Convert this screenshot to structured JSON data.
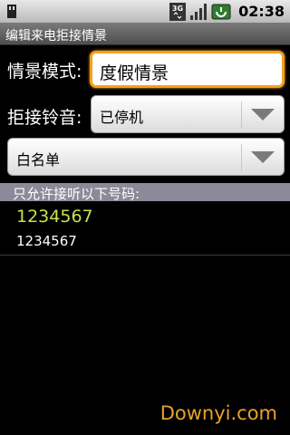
{
  "status_bar": {
    "time": "02:38",
    "network": "3G",
    "left_icon": "sd-card-icon",
    "battery_icon": "battery-charging-icon",
    "signal_icon": "signal-icon"
  },
  "title_bar": {
    "title": "编辑来电拒接情景"
  },
  "scene_mode": {
    "label": "情景模式:",
    "value": "度假情景"
  },
  "reject_ringtone": {
    "label": "拒接铃音:",
    "value": "已停机"
  },
  "list_type": {
    "value": "白名单"
  },
  "allowed_section": {
    "header": "只允许接听以下号码:",
    "numbers": [
      "1234567",
      "1234567"
    ]
  },
  "watermark": "Downyi.com",
  "colors": {
    "accent_focus": "#f5a01e",
    "highlight_number": "#c8e04a",
    "section_header": "#8a8a98",
    "watermark": "#e8a22a"
  }
}
